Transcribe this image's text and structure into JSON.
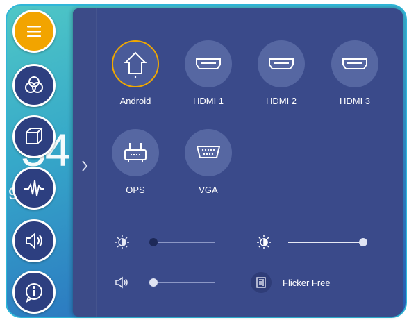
{
  "background": {
    "clock_fragment": "54",
    "date_fragment": "9, 20"
  },
  "sidebar": {
    "buttons": [
      {
        "name": "menu",
        "icon": "hamburger-icon"
      },
      {
        "name": "color",
        "icon": "rgb-circles-icon"
      },
      {
        "name": "3d",
        "icon": "cube-icon"
      },
      {
        "name": "audio-wave",
        "icon": "waveform-icon"
      },
      {
        "name": "sound",
        "icon": "speaker-icon"
      },
      {
        "name": "info",
        "icon": "info-icon"
      }
    ]
  },
  "sources": [
    {
      "label": "Android",
      "icon": "home-icon",
      "active": true
    },
    {
      "label": "HDMI 1",
      "icon": "hdmi-icon",
      "active": false
    },
    {
      "label": "HDMI 2",
      "icon": "hdmi-icon",
      "active": false
    },
    {
      "label": "HDMI 3",
      "icon": "hdmi-icon",
      "active": false
    },
    {
      "label": "OPS",
      "icon": "ops-icon",
      "active": false
    },
    {
      "label": "VGA",
      "icon": "vga-icon",
      "active": false
    }
  ],
  "sliders": {
    "backlight": {
      "icon": "backlight-icon",
      "level": 0.0
    },
    "brightness": {
      "icon": "brightness-icon",
      "level": 1.0
    },
    "volume": {
      "icon": "volume-icon",
      "level": 0.0
    }
  },
  "flicker": {
    "label": "Flicker Free",
    "icon": "flicker-free-icon"
  },
  "colors": {
    "panel": "#3a4a8a",
    "accent": "#f2a400",
    "icon_bg": "#5667a2"
  }
}
